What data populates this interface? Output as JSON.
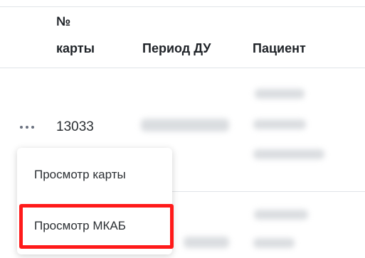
{
  "table": {
    "headers": {
      "card_number_line1": "№",
      "card_number_line2": "карты",
      "period": "Период ДУ",
      "patient": "Пациент"
    },
    "rows": [
      {
        "actions_icon": "more-horizontal-icon",
        "card_number": "13033"
      }
    ]
  },
  "context_menu": {
    "items": [
      {
        "label": "Просмотр карты"
      },
      {
        "label": "Просмотр МКАБ"
      }
    ],
    "highlight_color": "#ff1a1a"
  }
}
